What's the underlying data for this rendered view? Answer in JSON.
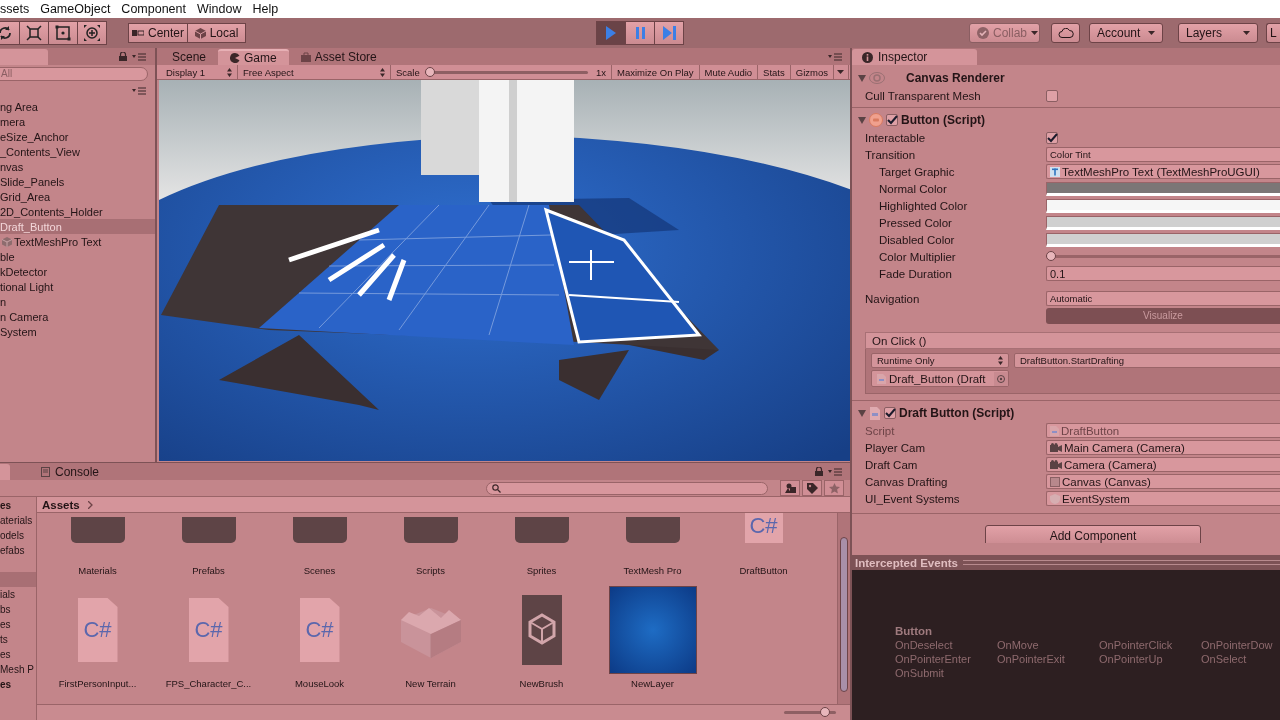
{
  "menu_bar": {
    "items": [
      "ssets",
      "GameObject",
      "Component",
      "Window",
      "Help"
    ]
  },
  "toolbar": {
    "pivot": [
      "Center",
      "Local"
    ],
    "playback": [
      {
        "kind": "play",
        "selected": true
      },
      {
        "kind": "pause",
        "selected": false
      },
      {
        "kind": "step",
        "selected": false
      }
    ],
    "collab": {
      "label": "Collab",
      "disabled": true
    },
    "account": "Account",
    "layers": "Layers",
    "layout": "L"
  },
  "hierarchy": {
    "search": {
      "placeholder": "All"
    },
    "items": [
      {
        "label": "ng Area",
        "selected": false
      },
      {
        "label": "mera",
        "selected": false
      },
      {
        "label": "eSize_Anchor",
        "selected": false
      },
      {
        "label": "_Contents_View",
        "selected": false
      },
      {
        "label": "nvas",
        "selected": false
      },
      {
        "label": "Slide_Panels",
        "selected": false
      },
      {
        "label": "Grid_Area",
        "selected": false
      },
      {
        "label": "2D_Contents_Holder",
        "selected": false
      },
      {
        "label": "Draft_Button",
        "selected": true,
        "children": [
          {
            "label": "TextMeshPro Text",
            "selected": false
          }
        ]
      },
      {
        "label": "ble",
        "selected": false
      },
      {
        "label": "kDetector",
        "selected": false
      },
      {
        "label": "tional Light",
        "selected": false
      },
      {
        "label": "n",
        "selected": false
      },
      {
        "label": "n Camera",
        "selected": false
      },
      {
        "label": "System",
        "selected": false
      }
    ]
  },
  "game_view": {
    "tabs": [
      {
        "kind": "scene",
        "label": "Scene",
        "selected": false
      },
      {
        "kind": "game",
        "label": "Game",
        "selected": true
      },
      {
        "kind": "store",
        "label": "Asset Store",
        "selected": false
      }
    ],
    "display": "Display 1",
    "aspect": "Free Aspect",
    "scale_label": "Scale",
    "scale": {
      "level": 0
    },
    "scale_reading": "1x",
    "toggles": [
      "Maximize On Play",
      "Mute Audio",
      "Stats"
    ],
    "gizmos": "Gizmos"
  },
  "inspector": {
    "tab": "Inspector",
    "components": [
      {
        "kind": "canvas_renderer",
        "title": "Canvas Renderer",
        "expanded": true,
        "properties": [
          {
            "kind": "checkbox",
            "label": "Cull Transparent Mesh",
            "checked": false
          }
        ]
      },
      {
        "kind": "button_script",
        "title": "Button (Script)",
        "expanded": true,
        "enabled": true,
        "properties": [
          {
            "kind": "checkbox",
            "label": "Interactable",
            "checked": true
          },
          {
            "kind": "dropdown",
            "label": "Transition",
            "value": "Color Tint",
            "children": [
              {
                "kind": "object_text",
                "label": "Target Graphic",
                "value": "TextMeshPro Text (TextMeshProUGUI)",
                "disabled": false
              },
              {
                "kind": "color",
                "label": "Normal Color",
                "color": "#7b7676"
              },
              {
                "kind": "color",
                "label": "Highlighted Color",
                "color": "#f6f6f6"
              },
              {
                "kind": "color",
                "label": "Pressed Color",
                "color": "#d0d0d0"
              },
              {
                "kind": "color",
                "label": "Disabled Color",
                "color": "#d0d0d0"
              },
              {
                "kind": "slider",
                "label": "Color Multiplier",
                "level": 0
              },
              {
                "kind": "text",
                "label": "Fade Duration",
                "value": "0.1"
              }
            ]
          },
          {
            "kind": "dropdown",
            "label": "Navigation",
            "value": "Automatic"
          },
          {
            "kind": "button",
            "value": "Visualize"
          },
          {
            "kind": "event",
            "label": "On Click ()",
            "runtime": "Runtime Only",
            "function": "DraftButton.StartDrafting",
            "target": "Draft_Button (Draft"
          }
        ]
      },
      {
        "kind": "script",
        "title": "Draft Button (Script)",
        "expanded": true,
        "enabled": true,
        "properties": [
          {
            "kind": "object_script",
            "label": "Script",
            "value": "DraftButton",
            "disabled": true
          },
          {
            "kind": "object_camera",
            "label": "Player Cam",
            "value": "Main Camera (Camera)",
            "disabled": false
          },
          {
            "kind": "object_camera",
            "label": "Draft Cam",
            "value": "Camera (Camera)",
            "disabled": false
          },
          {
            "kind": "object_canvas",
            "label": "Canvas Drafting",
            "value": "Canvas (Canvas)",
            "disabled": false
          },
          {
            "kind": "object_event_system",
            "label": "UI_Event Systems",
            "value": "EventSystem",
            "disabled": false
          }
        ]
      }
    ],
    "add_component": "Add Component"
  },
  "intercepted_events": {
    "title": "Intercepted Events",
    "group": "Button",
    "events": [
      "OnDeselect",
      "OnMove",
      "OnPointerClick",
      "OnPointerDow",
      "OnPointerEnter",
      "OnPointerExit",
      "OnPointerUp",
      "OnSelect",
      "OnSubmit"
    ]
  },
  "project": {
    "console_tab": "Console",
    "sidebar": {
      "favorites": {
        "label": "es",
        "items": [
          "aterials",
          "odels",
          "efabs"
        ]
      },
      "assets": {
        "selected": true,
        "items": [
          "ials",
          "bs",
          "es",
          "ts",
          "es",
          "Mesh P"
        ]
      },
      "packages": {
        "label": "es"
      }
    },
    "breadcrumb": "Assets",
    "items": [
      {
        "kind": "folder",
        "name": "Materials"
      },
      {
        "kind": "folder",
        "name": "Prefabs"
      },
      {
        "kind": "folder",
        "name": "Scenes"
      },
      {
        "kind": "folder",
        "name": "Scripts"
      },
      {
        "kind": "folder",
        "name": "Sprites"
      },
      {
        "kind": "folder",
        "name": "TextMesh Pro"
      },
      {
        "kind": "script",
        "name": "DraftButton",
        "icon_text": "C#"
      },
      {
        "kind": "script",
        "name": "FirstPersonInput...",
        "icon_text": "C#"
      },
      {
        "kind": "script",
        "name": "FPS_Character_C...",
        "icon_text": "C#"
      },
      {
        "kind": "script",
        "name": "MouseLook",
        "icon_text": "C#"
      },
      {
        "kind": "terrain",
        "name": "New Terrain"
      },
      {
        "kind": "brush",
        "name": "NewBrush"
      },
      {
        "kind": "texture",
        "name": "NewLayer"
      }
    ],
    "icon_size": {
      "level": 0.85
    }
  }
}
